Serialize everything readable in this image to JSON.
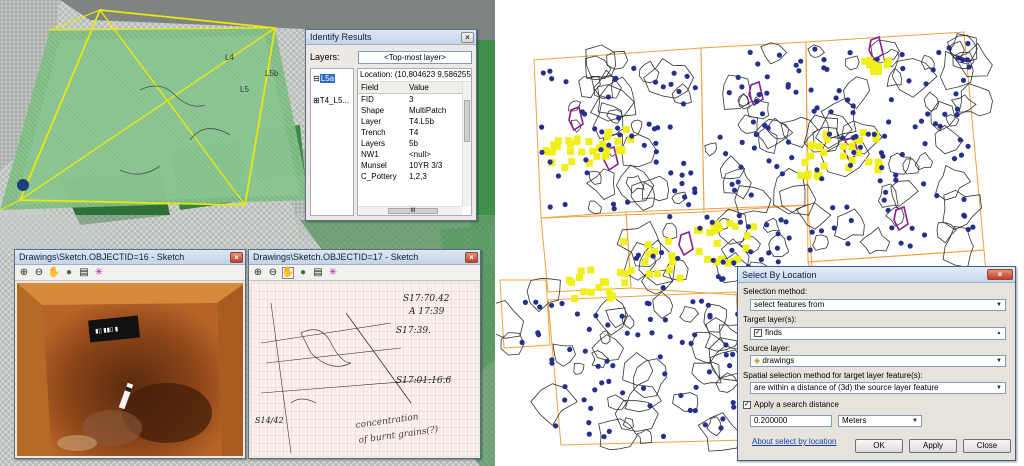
{
  "identify": {
    "title": "Identify Results",
    "layers_label": "Layers:",
    "layers_value": "<Top-most layer>",
    "tree": [
      {
        "toggle": "⊟",
        "label": "L5a"
      },
      {
        "toggle": "⊞",
        "label": "T4_L5..."
      }
    ],
    "location": "Location: (10,804623 9,586255)",
    "columns": [
      "Field",
      "Value"
    ],
    "rows": [
      {
        "field": "FID",
        "value": "3"
      },
      {
        "field": "Shape",
        "value": "MultiPatch"
      },
      {
        "field": "Layer",
        "value": "T4.L5b"
      },
      {
        "field": "Trench",
        "value": "T4"
      },
      {
        "field": "Layers",
        "value": "5b"
      },
      {
        "field": "NW1",
        "value": "<null>"
      },
      {
        "field": "Munsel",
        "value": "10YR 3/3"
      },
      {
        "field": "C_Pottery",
        "value": "1,2,3"
      }
    ],
    "hscroll_grip": "III"
  },
  "scene_labels": {
    "l4": "L4",
    "l5": "L5",
    "l5b": "L5b"
  },
  "sketch16": {
    "title": "Drawings\\Sketch.OBJECTID=16 - Sketch"
  },
  "sketch17": {
    "title": "Drawings\\Sketch.OBJECTID=17 - Sketch",
    "notes": [
      "S17:70.42",
      "A 17:39",
      "S17:39.",
      "S17:01:16.6",
      "concentration",
      "of burnt grains(?)",
      "S14/42"
    ]
  },
  "toolbar_icons": [
    "zoom-in-icon",
    "zoom-out-icon",
    "pan-hand-icon",
    "globe-icon",
    "properties-icon",
    "sparkle-icon"
  ],
  "toolbar_glyphs": [
    "⊕",
    "⊖",
    "✋",
    "●",
    "▤",
    "✳"
  ],
  "sbl": {
    "title": "Select By Location",
    "selection_method_label": "Selection method:",
    "selection_method_value": "select features from",
    "target_label": "Target layer(s):",
    "target_item": "finds",
    "target_checked": true,
    "source_label": "Source layer:",
    "source_value": "drawings",
    "spatial_label": "Spatial selection method for target layer feature(s):",
    "spatial_value": "are within a distance of (3d) the source layer feature",
    "search_distance_label": "Apply a search distance",
    "search_distance_checked": true,
    "distance_value": "0.200000",
    "unit_value": "Meters",
    "about_link": "About select by location",
    "ok": "OK",
    "apply": "Apply",
    "close": "Close"
  },
  "colors": {
    "plan_fill": "#7fb87c",
    "highlight": "#e8e80a",
    "finds_dot": "#26308c",
    "selected_find": "#f0ef1a",
    "trench_grid": "#f0a040",
    "drawing_outline": "#333333",
    "magenta": "#8a1d8f"
  }
}
